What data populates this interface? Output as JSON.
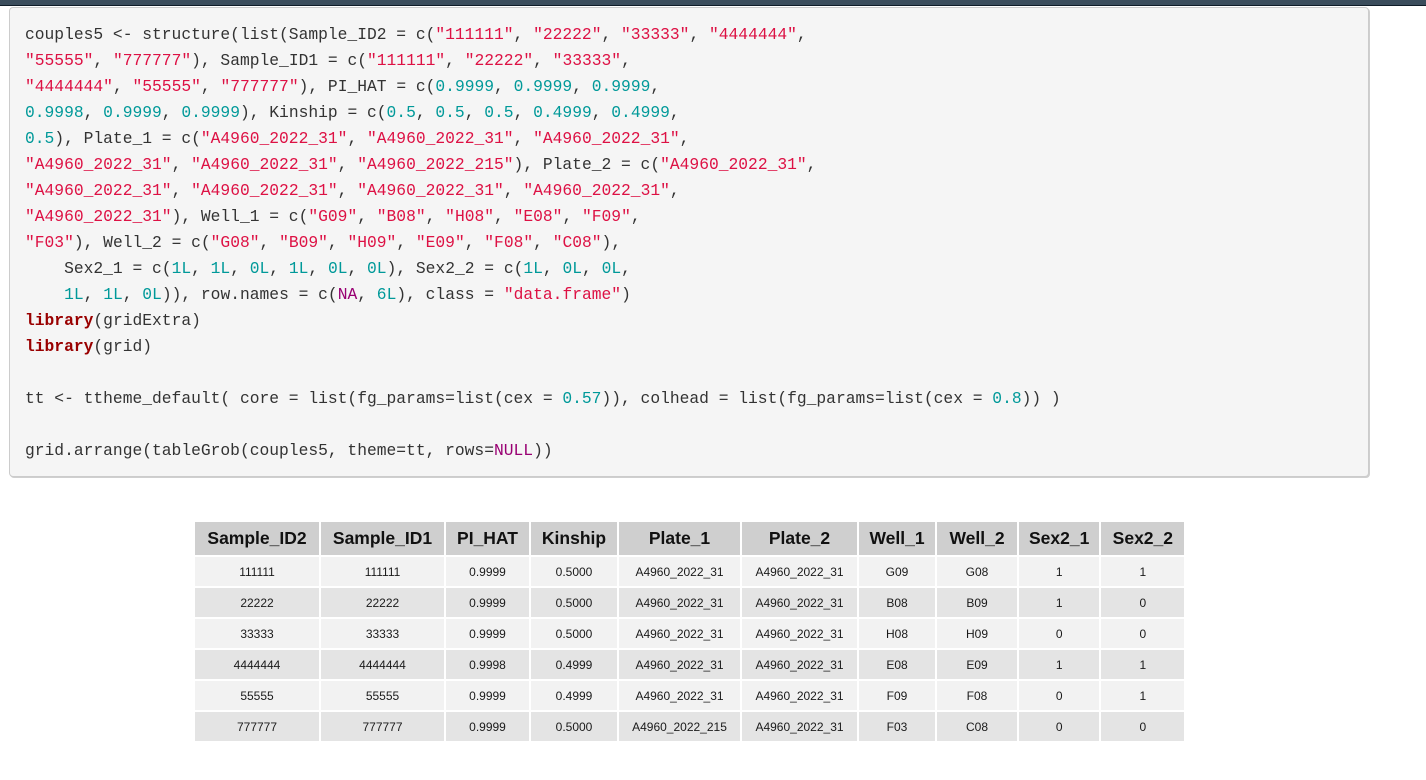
{
  "code": {
    "lines": [
      [
        [
          "t",
          "couples5 <- structure(list(Sample_ID2 = c("
        ],
        [
          "s",
          "\"111111\""
        ],
        [
          "t",
          ", "
        ],
        [
          "s",
          "\"22222\""
        ],
        [
          "t",
          ", "
        ],
        [
          "s",
          "\"33333\""
        ],
        [
          "t",
          ", "
        ],
        [
          "s",
          "\"4444444\""
        ],
        [
          "t",
          ", "
        ]
      ],
      [
        [
          "s",
          "\"55555\""
        ],
        [
          "t",
          ", "
        ],
        [
          "s",
          "\"777777\""
        ],
        [
          "t",
          "), Sample_ID1 = c("
        ],
        [
          "s",
          "\"111111\""
        ],
        [
          "t",
          ", "
        ],
        [
          "s",
          "\"22222\""
        ],
        [
          "t",
          ", "
        ],
        [
          "s",
          "\"33333\""
        ],
        [
          "t",
          ", "
        ]
      ],
      [
        [
          "s",
          "\"4444444\""
        ],
        [
          "t",
          ", "
        ],
        [
          "s",
          "\"55555\""
        ],
        [
          "t",
          ", "
        ],
        [
          "s",
          "\"777777\""
        ],
        [
          "t",
          "), PI_HAT = c("
        ],
        [
          "n",
          "0.9999"
        ],
        [
          "t",
          ", "
        ],
        [
          "n",
          "0.9999"
        ],
        [
          "t",
          ", "
        ],
        [
          "n",
          "0.9999"
        ],
        [
          "t",
          ", "
        ]
      ],
      [
        [
          "n",
          "0.9998"
        ],
        [
          "t",
          ", "
        ],
        [
          "n",
          "0.9999"
        ],
        [
          "t",
          ", "
        ],
        [
          "n",
          "0.9999"
        ],
        [
          "t",
          "), Kinship = c("
        ],
        [
          "n",
          "0.5"
        ],
        [
          "t",
          ", "
        ],
        [
          "n",
          "0.5"
        ],
        [
          "t",
          ", "
        ],
        [
          "n",
          "0.5"
        ],
        [
          "t",
          ", "
        ],
        [
          "n",
          "0.4999"
        ],
        [
          "t",
          ", "
        ],
        [
          "n",
          "0.4999"
        ],
        [
          "t",
          ", "
        ]
      ],
      [
        [
          "n",
          "0.5"
        ],
        [
          "t",
          "), Plate_1 = c("
        ],
        [
          "s",
          "\"A4960_2022_31\""
        ],
        [
          "t",
          ", "
        ],
        [
          "s",
          "\"A4960_2022_31\""
        ],
        [
          "t",
          ", "
        ],
        [
          "s",
          "\"A4960_2022_31\""
        ],
        [
          "t",
          ", "
        ]
      ],
      [
        [
          "s",
          "\"A4960_2022_31\""
        ],
        [
          "t",
          ", "
        ],
        [
          "s",
          "\"A4960_2022_31\""
        ],
        [
          "t",
          ", "
        ],
        [
          "s",
          "\"A4960_2022_215\""
        ],
        [
          "t",
          "), Plate_2 = c("
        ],
        [
          "s",
          "\"A4960_2022_31\""
        ],
        [
          "t",
          ", "
        ]
      ],
      [
        [
          "s",
          "\"A4960_2022_31\""
        ],
        [
          "t",
          ", "
        ],
        [
          "s",
          "\"A4960_2022_31\""
        ],
        [
          "t",
          ", "
        ],
        [
          "s",
          "\"A4960_2022_31\""
        ],
        [
          "t",
          ", "
        ],
        [
          "s",
          "\"A4960_2022_31\""
        ],
        [
          "t",
          ", "
        ]
      ],
      [
        [
          "s",
          "\"A4960_2022_31\""
        ],
        [
          "t",
          "), Well_1 = c("
        ],
        [
          "s",
          "\"G09\""
        ],
        [
          "t",
          ", "
        ],
        [
          "s",
          "\"B08\""
        ],
        [
          "t",
          ", "
        ],
        [
          "s",
          "\"H08\""
        ],
        [
          "t",
          ", "
        ],
        [
          "s",
          "\"E08\""
        ],
        [
          "t",
          ", "
        ],
        [
          "s",
          "\"F09\""
        ],
        [
          "t",
          ", "
        ]
      ],
      [
        [
          "s",
          "\"F03\""
        ],
        [
          "t",
          "), Well_2 = c("
        ],
        [
          "s",
          "\"G08\""
        ],
        [
          "t",
          ", "
        ],
        [
          "s",
          "\"B09\""
        ],
        [
          "t",
          ", "
        ],
        [
          "s",
          "\"H09\""
        ],
        [
          "t",
          ", "
        ],
        [
          "s",
          "\"E09\""
        ],
        [
          "t",
          ", "
        ],
        [
          "s",
          "\"F08\""
        ],
        [
          "t",
          ", "
        ],
        [
          "s",
          "\"C08\""
        ],
        [
          "t",
          "),"
        ]
      ],
      [
        [
          "t",
          "    Sex2_1 = c("
        ],
        [
          "n",
          "1L"
        ],
        [
          "t",
          ", "
        ],
        [
          "n",
          "1L"
        ],
        [
          "t",
          ", "
        ],
        [
          "n",
          "0L"
        ],
        [
          "t",
          ", "
        ],
        [
          "n",
          "1L"
        ],
        [
          "t",
          ", "
        ],
        [
          "n",
          "0L"
        ],
        [
          "t",
          ", "
        ],
        [
          "n",
          "0L"
        ],
        [
          "t",
          "), Sex2_2 = c("
        ],
        [
          "n",
          "1L"
        ],
        [
          "t",
          ", "
        ],
        [
          "n",
          "0L"
        ],
        [
          "t",
          ", "
        ],
        [
          "n",
          "0L"
        ],
        [
          "t",
          ","
        ]
      ],
      [
        [
          "t",
          "    "
        ],
        [
          "n",
          "1L"
        ],
        [
          "t",
          ", "
        ],
        [
          "n",
          "1L"
        ],
        [
          "t",
          ", "
        ],
        [
          "n",
          "0L"
        ],
        [
          "t",
          ")), row.names = c("
        ],
        [
          "c",
          "NA"
        ],
        [
          "t",
          ", "
        ],
        [
          "n",
          "6L"
        ],
        [
          "t",
          "), class = "
        ],
        [
          "s",
          "\"data.frame\""
        ],
        [
          "t",
          ")"
        ]
      ],
      [
        [
          "k",
          "library"
        ],
        [
          "t",
          "(gridExtra)"
        ]
      ],
      [
        [
          "k",
          "library"
        ],
        [
          "t",
          "(grid)"
        ]
      ],
      [],
      [
        [
          "t",
          "tt <- ttheme_default( core = list(fg_params=list(cex = "
        ],
        [
          "n",
          "0.57"
        ],
        [
          "t",
          ")), colhead = list(fg_params=list(cex = "
        ],
        [
          "n",
          "0.8"
        ],
        [
          "t",
          ")) )"
        ]
      ],
      [],
      [
        [
          "t",
          "grid.arrange(tableGrob(couples5, theme=tt, rows="
        ],
        [
          "c",
          "NULL"
        ],
        [
          "t",
          "))"
        ]
      ]
    ]
  },
  "table": {
    "headers": [
      "Sample_ID2",
      "Sample_ID1",
      "PI_HAT",
      "Kinship",
      "Plate_1",
      "Plate_2",
      "Well_1",
      "Well_2",
      "Sex2_1",
      "Sex2_2"
    ],
    "rows": [
      [
        "111111",
        "111111",
        "0.9999",
        "0.5000",
        "A4960_2022_31",
        "A4960_2022_31",
        "G09",
        "G08",
        "1",
        "1"
      ],
      [
        "22222",
        "22222",
        "0.9999",
        "0.5000",
        "A4960_2022_31",
        "A4960_2022_31",
        "B08",
        "B09",
        "1",
        "0"
      ],
      [
        "33333",
        "33333",
        "0.9999",
        "0.5000",
        "A4960_2022_31",
        "A4960_2022_31",
        "H08",
        "H09",
        "0",
        "0"
      ],
      [
        "4444444",
        "4444444",
        "0.9998",
        "0.4999",
        "A4960_2022_31",
        "A4960_2022_31",
        "E08",
        "E09",
        "1",
        "1"
      ],
      [
        "55555",
        "55555",
        "0.9999",
        "0.4999",
        "A4960_2022_31",
        "A4960_2022_31",
        "F09",
        "F08",
        "0",
        "1"
      ],
      [
        "777777",
        "777777",
        "0.9999",
        "0.5000",
        "A4960_2022_215",
        "A4960_2022_31",
        "F03",
        "C08",
        "0",
        "0"
      ]
    ]
  },
  "colors": {
    "string": "#dd1144",
    "number": "#009999",
    "keyword": "#990000",
    "constant": "#990073",
    "header_bg": "#cfcfcf",
    "row_light": "#f2f2f2",
    "row_dark": "#e4e4e4"
  }
}
